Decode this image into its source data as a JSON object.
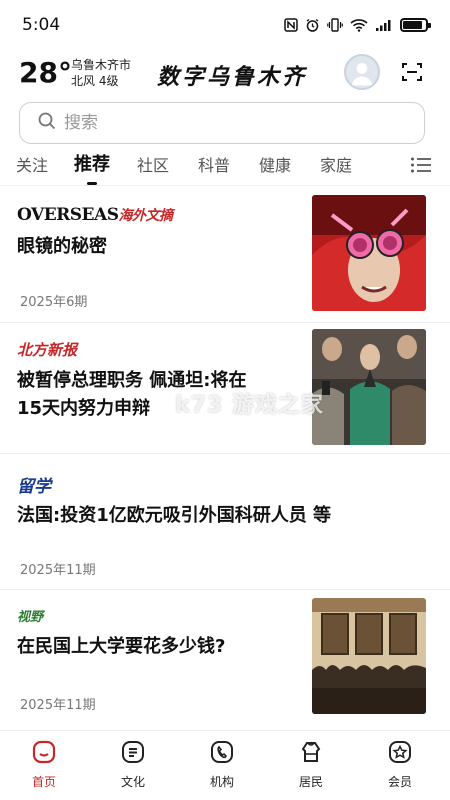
{
  "status_bar": {
    "time": "5:04",
    "battery_level": 0.85
  },
  "header": {
    "temperature": "28°",
    "city": "乌鲁木齐市",
    "wind": "北风  4级",
    "logo_text": "数字乌鲁木齐"
  },
  "search": {
    "placeholder": "搜索"
  },
  "tabs": [
    {
      "label": "关注",
      "active": false
    },
    {
      "label": "推荐",
      "active": true
    },
    {
      "label": "社区",
      "active": false
    },
    {
      "label": "科普",
      "active": false
    },
    {
      "label": "健康",
      "active": false
    },
    {
      "label": "家庭",
      "active": false
    }
  ],
  "feed": [
    {
      "source": "OVERSEAS海外文摘",
      "title_line1": "眼镜的秘密",
      "title_line2": "",
      "issue": "2025年6期",
      "source_color": "#c62828"
    },
    {
      "source": "北方新报",
      "title_line1": "被暂停总理职务  佩通坦:将在",
      "title_line2": "15天内努力申辩",
      "issue": "",
      "source_color": "#c62828"
    },
    {
      "source": "留学",
      "title_line1": "法国:投资1亿欧元吸引外国科研人员 等",
      "title_line2": "",
      "issue": "2025年11期",
      "source_color": "#1a3c8f"
    },
    {
      "source": "视野",
      "title_line1": "在民国上大学要花多少钱?",
      "title_line2": "",
      "issue": "2025年11期",
      "source_color": "#2e7d32"
    }
  ],
  "watermark": "k73 游戏之家",
  "bottom_nav": [
    {
      "label": "首页",
      "icon": "home-icon",
      "active": true
    },
    {
      "label": "文化",
      "icon": "document-list-icon",
      "active": false
    },
    {
      "label": "机构",
      "icon": "phone-icon",
      "active": false
    },
    {
      "label": "居民",
      "icon": "people-icon",
      "active": false
    },
    {
      "label": "会员",
      "icon": "member-badge-icon",
      "active": false
    }
  ],
  "colors": {
    "accent": "#c62828",
    "text": "#111111",
    "muted": "#777777"
  }
}
